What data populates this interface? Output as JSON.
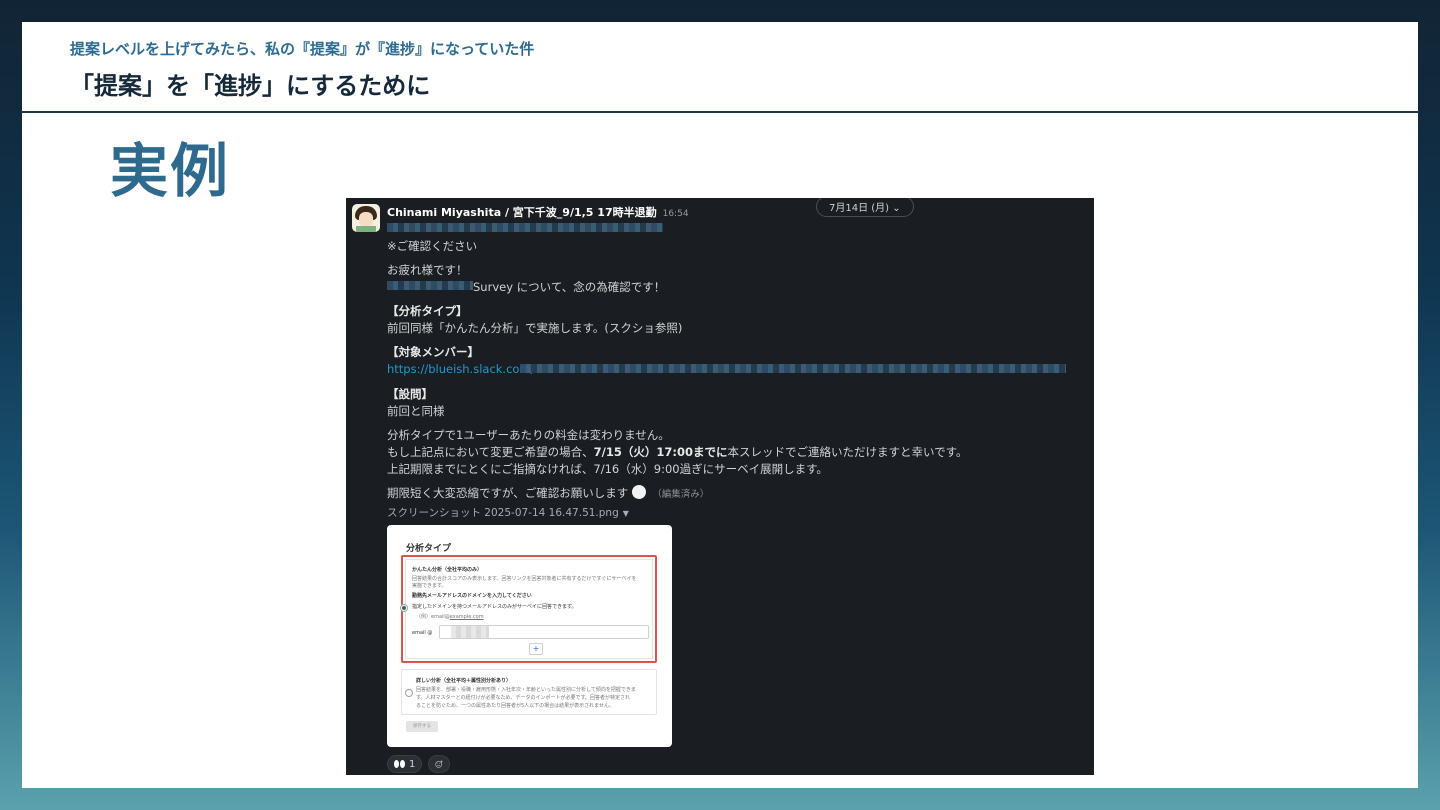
{
  "header": {
    "subtitle": "提案レベルを上げてみたら、私の『提案』が『進捗』になっていた件",
    "title": "「提案」を「進捗」にするために"
  },
  "section_title": "実例",
  "slack": {
    "date_pill": "7月14日 (月)",
    "date_caret": "⌄",
    "author": "Chinami Miyashita / 宮下千波_9/1,5 17時半退勤",
    "timestamp": "16:54",
    "lines": {
      "confirm": "※ご確認ください",
      "greeting": "お疲れ様です！",
      "survey_suffix": "Survey について、念の為確認です！",
      "analysis_type_heading": "【分析タイプ】",
      "analysis_type_body": "前回同様「かんたん分析」で実施します。(スクショ参照)",
      "members_heading": "【対象メンバー】",
      "members_link": "https://blueish.slack.com/",
      "questions_heading": "【設問】",
      "questions_body": "前回と同様",
      "price_note": "分析タイプで1ユーザーあたりの料金は変わりません。",
      "change_pre": "もし上記点において変更ご希望の場合、",
      "change_deadline": "7/15（火）17:00までに",
      "change_post": "本スレッドでご連絡いただけますと幸いです。",
      "deploy_note": "上記期限までにとくにご指摘なければ、7/16（水）9:00過ぎにサーベイ展開します。",
      "closing": "期限短く大変恐縮ですが、ご確認お願いします",
      "edited": "（編集済み）"
    },
    "file_name": "スクリーンショット 2025-07-14 16.47.51.png",
    "file_caret": "▼",
    "screenshot": {
      "title": "分析タイプ",
      "option1_label": "かんたん分析（全社平均のみ）",
      "option1_desc1": "回答結果の合計スコアのみ表示します。回答リンクを回答対象者に共有するだけですぐにサーベイを",
      "option1_desc2": "実施できます。",
      "domain_prompt": "勤務先メールアドレスのドメインを入力してください",
      "domain_desc": "指定したドメインを持つメールアドレスのみがサーベイに回答できます。",
      "domain_example_pre": "（例）email@",
      "domain_example_link": "example.com",
      "email_label": "email @",
      "plus": "+",
      "option2_label": "詳しい分析（全社平均＋属性別分析あり）",
      "option2_desc1": "回答結果を、部署・役職・雇用形態・入社年次・年齢といった属性別に分析して傾向を把握できま",
      "option2_desc2": "す。人材マスターとの紐付けが必要なため、データのインポートが必要です。回答者が特定され",
      "option2_desc3": "ることを防ぐため、一つの属性あたり回答者が5人以下の場合は結果が表示されません。",
      "save": "保存する"
    },
    "reactions": [
      {
        "icon": "eyes-icon",
        "count": "1"
      },
      {
        "icon": "add-reaction-icon",
        "count": ""
      }
    ]
  },
  "colors": {
    "accent": "#2e6a8d",
    "slack_bg": "#1a1d21",
    "link": "#1d9bd1",
    "highlight_box": "#d9534f"
  }
}
